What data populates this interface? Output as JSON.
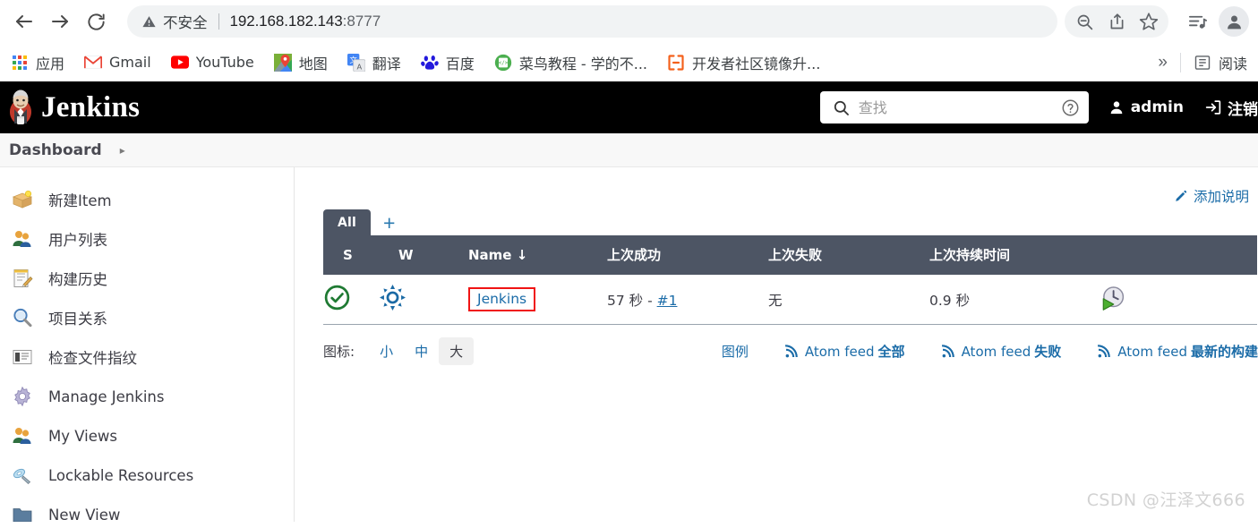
{
  "browser": {
    "nav": {
      "back": "back-arrow",
      "forward": "forward-arrow",
      "reload": "reload"
    },
    "omnibox": {
      "security_warning": "不安全",
      "url_host": "192.168.182.143",
      "url_port": ":8777"
    },
    "toolbar_icons": [
      "zoom-out-icon",
      "share-icon",
      "star-icon",
      "media-playlist-icon",
      "profile-avatar-icon"
    ],
    "bookmarks": [
      {
        "label": "应用",
        "icon": "apps-grid-icon"
      },
      {
        "label": "Gmail",
        "icon": "gmail-icon"
      },
      {
        "label": "YouTube",
        "icon": "youtube-icon"
      },
      {
        "label": "地图",
        "icon": "google-maps-icon"
      },
      {
        "label": "翻译",
        "icon": "google-translate-icon"
      },
      {
        "label": "百度",
        "icon": "baidu-icon"
      },
      {
        "label": "菜鸟教程 - 学的不...",
        "icon": "runoob-icon"
      },
      {
        "label": "开发者社区镜像升...",
        "icon": "devcommunity-icon"
      }
    ],
    "overflow": "»",
    "reading_list": "阅读"
  },
  "jenkins": {
    "header": {
      "title": "Jenkins",
      "search_placeholder": "查找",
      "search_value": "",
      "help_icon": "help-circle-icon",
      "user_name": "admin",
      "logout_label": "注销"
    },
    "breadcrumb": {
      "root": "Dashboard",
      "chevron": "▸"
    },
    "sidebar": [
      {
        "label": "新建Item",
        "icon": "new-item-icon"
      },
      {
        "label": "用户列表",
        "icon": "people-icon"
      },
      {
        "label": "构建历史",
        "icon": "build-history-icon"
      },
      {
        "label": "项目关系",
        "icon": "project-relationship-icon"
      },
      {
        "label": "检查文件指纹",
        "icon": "fingerprint-icon"
      },
      {
        "label": "Manage Jenkins",
        "icon": "gear-icon"
      },
      {
        "label": "My Views",
        "icon": "people-icon"
      },
      {
        "label": "Lockable Resources",
        "icon": "lock-resource-icon"
      },
      {
        "label": "New View",
        "icon": "folder-icon"
      }
    ],
    "main": {
      "add_description": "添加说明",
      "tabs": [
        {
          "label": "All",
          "active": true
        }
      ],
      "tab_add": "+",
      "table": {
        "headers": [
          "S",
          "W",
          "Name  ↓",
          "上次成功",
          "上次失败",
          "上次持续时间",
          ""
        ],
        "rows": [
          {
            "status": "success-icon",
            "weather": "sunny-icon",
            "name": "Jenkins",
            "last_success": "57 秒 - ",
            "last_success_build": "#1",
            "last_failure": "无",
            "last_duration": "0.9 秒",
            "action": "schedule-build-icon"
          }
        ]
      },
      "icon_size": {
        "label": "图标:",
        "options": [
          {
            "label": "小",
            "active": false
          },
          {
            "label": "中",
            "active": false
          },
          {
            "label": "大",
            "active": true
          }
        ]
      },
      "legend": "图例",
      "feeds": [
        {
          "prefix": "Atom feed ",
          "suffix": "全部"
        },
        {
          "prefix": "Atom feed ",
          "suffix": "失败"
        },
        {
          "prefix": "Atom feed ",
          "suffix": "最新的构建"
        }
      ]
    }
  },
  "watermark": "CSDN @汪泽文666",
  "colors": {
    "jenkins_header_bg": "#000000",
    "table_header_bg": "#4d5564",
    "link_blue": "#1b6ca8",
    "success_green": "#1f7a33",
    "weather_blue": "#1b6aa5",
    "highlight_red": "#f01414"
  }
}
